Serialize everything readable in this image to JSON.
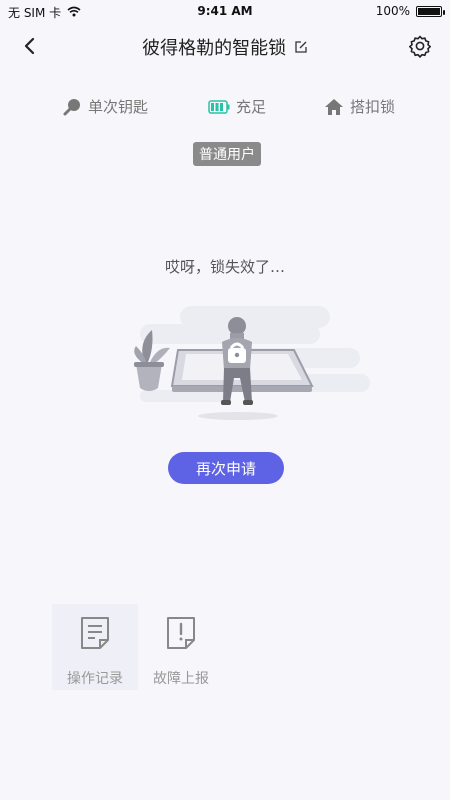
{
  "status": {
    "carrier": "无 SIM 卡",
    "time": "9:41 AM",
    "battery": "100%"
  },
  "nav": {
    "title": "彼得格勒的智能锁"
  },
  "info": {
    "key_type": "单次钥匙",
    "battery_status": "充足",
    "lock_type": "搭扣锁"
  },
  "user_badge": "普通用户",
  "message": "哎呀，锁失效了…",
  "reapply_label": "再次申请",
  "actions": [
    {
      "label": "操作记录",
      "icon": "document-icon"
    },
    {
      "label": "故障上报",
      "icon": "report-icon"
    }
  ],
  "colors": {
    "accent": "#5e63e6",
    "battery_green": "#27c3a6",
    "badge": "#8a8a8a"
  }
}
